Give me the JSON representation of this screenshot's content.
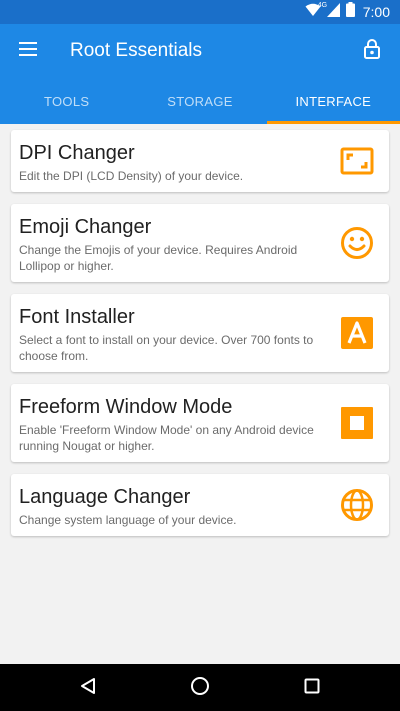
{
  "status_bar": {
    "time": "7:00",
    "network_type": "4G",
    "icons": [
      "wifi-icon",
      "cellular-signal-icon",
      "battery-icon"
    ]
  },
  "app_bar": {
    "title": "Root Essentials",
    "left_icon": "hamburger-menu-icon",
    "right_icon": "lock-open-icon"
  },
  "tabs": [
    {
      "label": "TOOLS",
      "active": false
    },
    {
      "label": "STORAGE",
      "active": false
    },
    {
      "label": "INTERFACE",
      "active": true
    }
  ],
  "items": [
    {
      "title": "DPI Changer",
      "description": "Edit the DPI (LCD Density) of your device.",
      "icon": "aspect-ratio-icon"
    },
    {
      "title": "Emoji Changer",
      "description": "Change the Emojis of your device. Requires Android Lollipop or higher.",
      "icon": "smiley-face-icon"
    },
    {
      "title": "Font Installer",
      "description": "Select a font to install on your device. Over 700 fonts to choose from.",
      "icon": "font-letter-a-icon"
    },
    {
      "title": "Freeform Window Mode",
      "description": "Enable 'Freeform Window Mode' on any Android device running Nougat or higher.",
      "icon": "freeform-window-icon"
    },
    {
      "title": "Language Changer",
      "description": "Change system language of your device.",
      "icon": "globe-icon"
    }
  ],
  "nav_bar": {
    "icons": [
      "back-icon",
      "home-icon",
      "recents-icon"
    ]
  },
  "colors": {
    "primary": "#1e88e5",
    "primary_dark": "#1a6fc9",
    "accent": "#ff9800",
    "background": "#f2f2f2"
  }
}
